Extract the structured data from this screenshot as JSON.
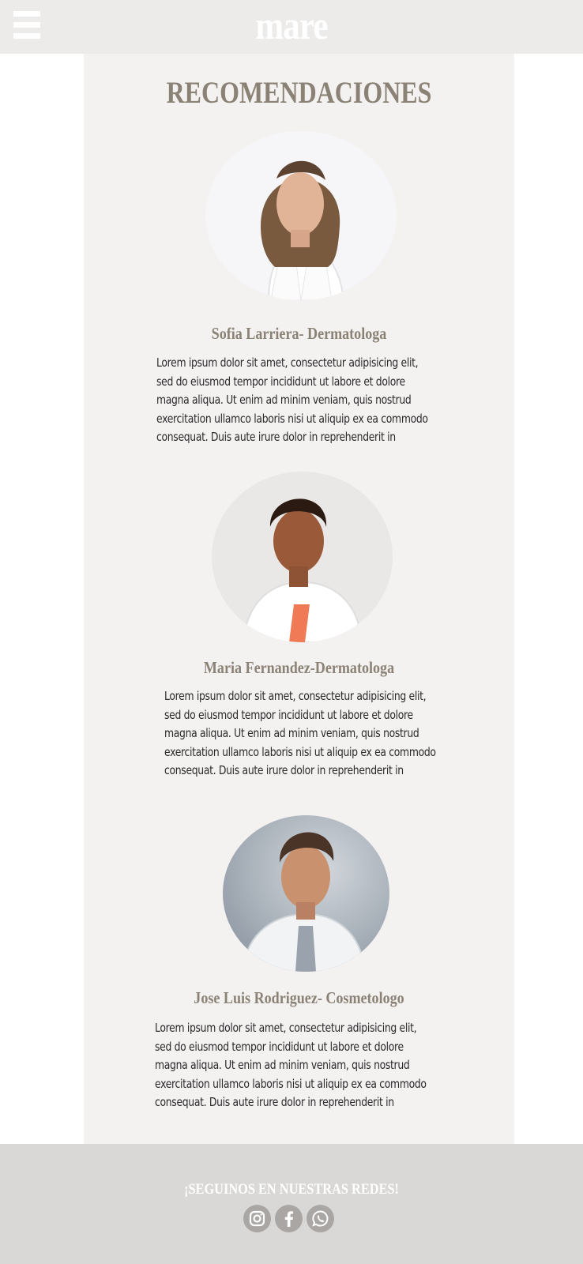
{
  "header": {
    "logo": "mare",
    "menu_icon": "hamburger-menu-icon"
  },
  "main": {
    "title": "RECOMENDACIONES",
    "profiles": [
      {
        "name": "Sofia Larriera- Dermatologa",
        "bio": [
          "Lorem ipsum dolor sit amet, consectetur adipisicing elit,",
          "sed do eiusmod tempor incididunt ut labore et dolore",
          "magna aliqua. Ut enim ad minim veniam, quis nostrud",
          "exercitation ullamco laboris nisi ut aliquip ex ea commodo",
          "consequat. Duis aute irure dolor in reprehenderit in"
        ]
      },
      {
        "name": "Maria Fernandez-Dermatologa",
        "bio": [
          "Lorem ipsum dolor sit amet, consectetur adipisicing elit,",
          "sed do eiusmod tempor incididunt ut labore et dolore",
          "magna aliqua. Ut enim ad minim veniam, quis nostrud",
          "exercitation ullamco laboris nisi ut aliquip ex ea commodo",
          "consequat. Duis aute irure dolor in reprehenderit in"
        ]
      },
      {
        "name": "Jose Luis Rodriguez- Cosmetologo",
        "bio": [
          "Lorem ipsum dolor sit amet, consectetur adipisicing elit,",
          "sed do eiusmod tempor incididunt ut labore et dolore",
          "magna aliqua. Ut enim ad minim veniam, quis nostrud",
          "exercitation ullamco laboris nisi ut aliquip ex ea commodo",
          "consequat. Duis aute irure dolor in reprehenderit in"
        ]
      }
    ]
  },
  "footer": {
    "follow_text": "¡SEGUINOS EN NUESTRAS REDES!",
    "social_icons": [
      "instagram-icon",
      "facebook-icon",
      "whatsapp-icon"
    ]
  },
  "colors": {
    "header_bg": "#ecebe9",
    "panel_bg": "#f4f1f1",
    "title_color": "#8b8276",
    "footer_bg": "#d9d8d7",
    "social_bg": "#a9a6a3"
  }
}
